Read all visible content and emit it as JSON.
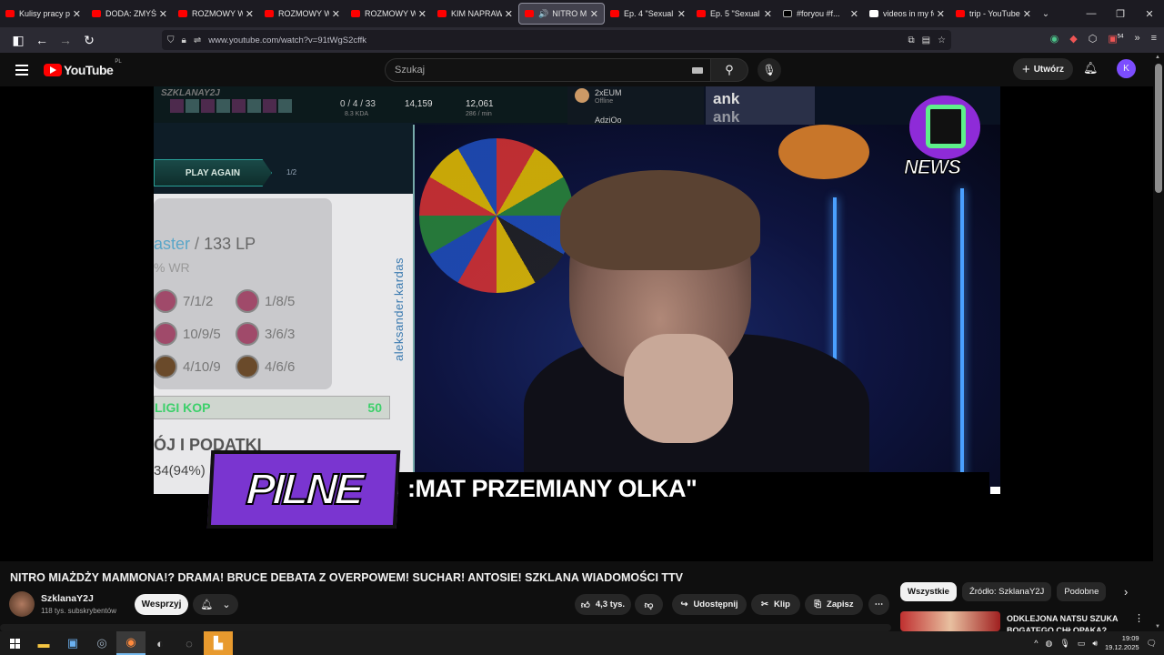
{
  "browser": {
    "tabs": [
      {
        "label": "Kulisy pracy pr...",
        "favicon": "youtube-icon"
      },
      {
        "label": "DODA: ZMYŚLO...",
        "favicon": "youtube-icon"
      },
      {
        "label": "ROZMOWY W T...",
        "favicon": "youtube-icon"
      },
      {
        "label": "ROZMOWY W T...",
        "favicon": "youtube-icon"
      },
      {
        "label": "ROZMOWY W T...",
        "favicon": "youtube-icon"
      },
      {
        "label": "KIM NAPRAWDĘ...",
        "favicon": "youtube-icon"
      },
      {
        "label": "NITRO MIA...",
        "favicon": "youtube-icon",
        "active": true
      },
      {
        "label": "Ep. 4 \"Sexual Be...",
        "favicon": "youtube-icon"
      },
      {
        "label": "Ep. 5 \"Sexual Be...",
        "favicon": "youtube-icon"
      },
      {
        "label": "#foryou #f...",
        "favicon": "tiktok-icon"
      },
      {
        "label": "videos in my fol...",
        "favicon": "x-icon"
      },
      {
        "label": "trip - YouTube",
        "favicon": "youtube-icon"
      }
    ],
    "url": "www.youtube.com/watch?v=91tWgS2cffk",
    "extension_badge": "54"
  },
  "youtube": {
    "logo_text": "YouTube",
    "region": "PL",
    "search_placeholder": "Szukaj",
    "create_label": "Utwórz",
    "avatar_letter": "K"
  },
  "video_frame": {
    "stats_kda": "0 / 4 / 33",
    "stats_kda_sub": "8.3 KDA",
    "stats_gold": "14,159",
    "stats_cs": "12,061",
    "stats_cs_sub": "286 / min",
    "overlay_name": "SZKLANAY2J",
    "play_again": "PLAY AGAIN",
    "party_count": "1/2",
    "rank_tier": "aster",
    "rank_lp": "133 LP",
    "winrate": "% WR",
    "games": [
      "7/1/2",
      "1/8/5",
      "10/9/5",
      "3/6/3",
      "4/10/9",
      "4/6/6"
    ],
    "handle": "aleksander.kardas",
    "kop_label": "LIGI KOP",
    "kop_value": "50",
    "podatki": "ÓJ I PODATKI",
    "percent": "34(94%)",
    "chat_user": "2xEUM",
    "chat_status": "Offline",
    "chat_user2": "AdziOo",
    "ank_label": "ank",
    "news_label": "NEWS",
    "pilne": "PILNE",
    "ticker": ":MAT PRZEMIANY OLKA\""
  },
  "video_info": {
    "title": "NITRO MIAŻDŻY MAMMONA!? DRAMA! BRUCE DEBATA Z OVERPOWEM! SUCHAR! ANTOSIE! SZKLANA WIADOMOŚCI TTV",
    "channel": "SzklanaY2J",
    "subscribers": "118 tys. subskrybentów",
    "support_label": "Wesprzyj",
    "likes": "4,3 tys.",
    "share_label": "Udostępnij",
    "clip_label": "Klip",
    "save_label": "Zapisz"
  },
  "sidebar": {
    "chips": [
      "Wszystkie",
      "Źródło: SzklanaY2J",
      "Podobne"
    ],
    "rec_title": "ODKLEJONA NATSU SZUKA BOGATEGO CHŁOPAKA?"
  },
  "taskbar": {
    "time": "19:09",
    "date": "19.12.2025"
  }
}
